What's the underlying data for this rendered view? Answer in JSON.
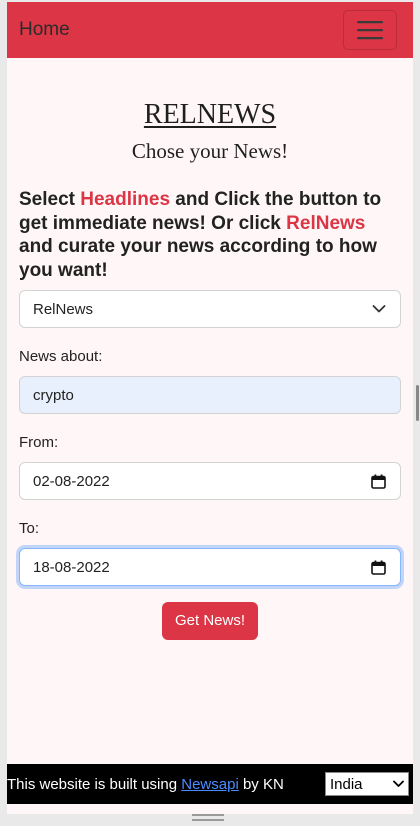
{
  "navbar": {
    "brand": "Home",
    "menu_icon": "hamburger-menu-icon"
  },
  "header": {
    "title": "RELNEWS",
    "subtitle": "Chose your News!"
  },
  "intro": {
    "part1": "Select ",
    "headlines": "Headlines",
    "part2": " and Click the button to get immediate news! Or click ",
    "relnews": "RelNews",
    "part3": " and curate your news according to how you want!"
  },
  "mode_select": {
    "value": "RelNews"
  },
  "form": {
    "news_about_label": "News about:",
    "news_about_value": "crypto",
    "from_label": "From:",
    "from_value": "02-08-2022",
    "to_label": "To:",
    "to_value": "18-08-2022",
    "submit_label": "Get News!"
  },
  "footer": {
    "text1": "This website is built using ",
    "link": "Newsapi",
    "text2": " by KN",
    "country": "India"
  },
  "colors": {
    "accent": "#dc3545",
    "page_bg": "#fff7f7",
    "footer_bg": "#000000",
    "link": "#4a8cff"
  }
}
